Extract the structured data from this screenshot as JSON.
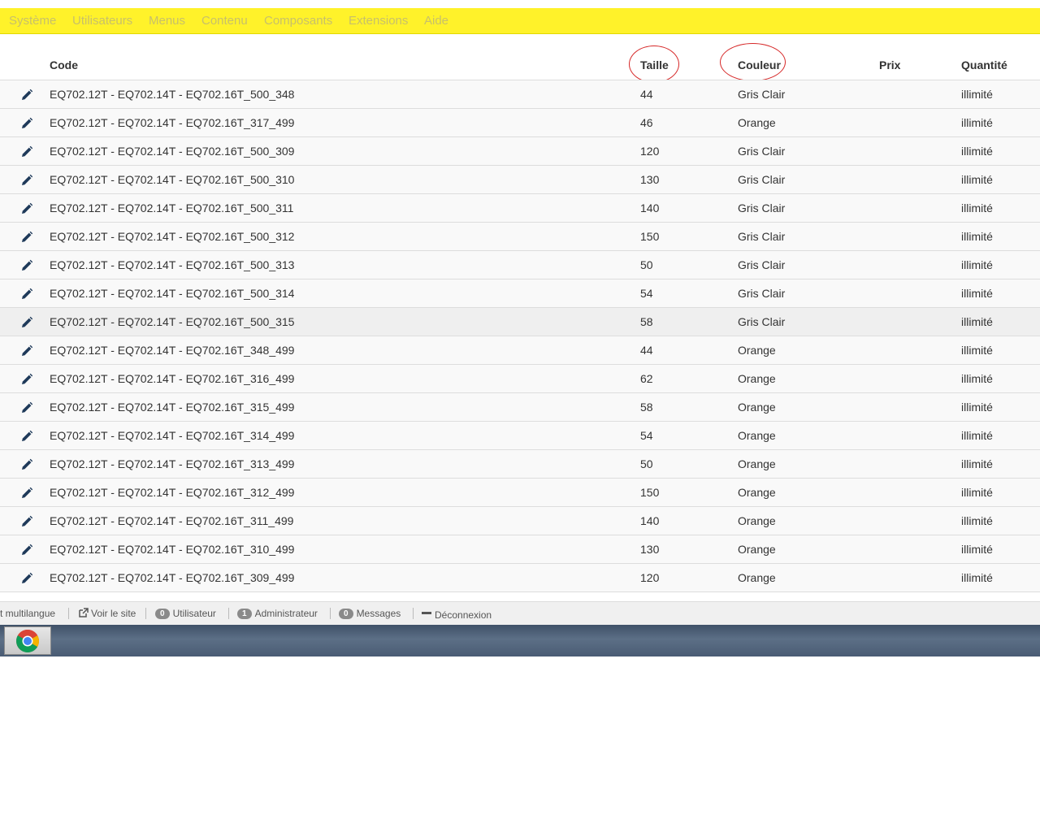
{
  "menubar": {
    "items": [
      "Système",
      "Utilisateurs",
      "Menus",
      "Contenu",
      "Composants",
      "Extensions",
      "Aide"
    ]
  },
  "table": {
    "headers": {
      "code": "Code",
      "taille": "Taille",
      "couleur": "Couleur",
      "prix": "Prix",
      "quantite": "Quantité"
    },
    "rows": [
      {
        "code": "EQ702.12T - EQ702.14T - EQ702.16T_500_348",
        "taille": "44",
        "couleur": "Gris Clair",
        "prix": "",
        "quantite": "illimité"
      },
      {
        "code": "EQ702.12T - EQ702.14T - EQ702.16T_317_499",
        "taille": "46",
        "couleur": "Orange",
        "prix": "",
        "quantite": "illimité"
      },
      {
        "code": "EQ702.12T - EQ702.14T - EQ702.16T_500_309",
        "taille": "120",
        "couleur": "Gris Clair",
        "prix": "",
        "quantite": "illimité"
      },
      {
        "code": "EQ702.12T - EQ702.14T - EQ702.16T_500_310",
        "taille": "130",
        "couleur": "Gris Clair",
        "prix": "",
        "quantite": "illimité"
      },
      {
        "code": "EQ702.12T - EQ702.14T - EQ702.16T_500_311",
        "taille": "140",
        "couleur": "Gris Clair",
        "prix": "",
        "quantite": "illimité"
      },
      {
        "code": "EQ702.12T - EQ702.14T - EQ702.16T_500_312",
        "taille": "150",
        "couleur": "Gris Clair",
        "prix": "",
        "quantite": "illimité"
      },
      {
        "code": "EQ702.12T - EQ702.14T - EQ702.16T_500_313",
        "taille": "50",
        "couleur": "Gris Clair",
        "prix": "",
        "quantite": "illimité"
      },
      {
        "code": "EQ702.12T - EQ702.14T - EQ702.16T_500_314",
        "taille": "54",
        "couleur": "Gris Clair",
        "prix": "",
        "quantite": "illimité"
      },
      {
        "code": "EQ702.12T - EQ702.14T - EQ702.16T_500_315",
        "taille": "58",
        "couleur": "Gris Clair",
        "prix": "",
        "quantite": "illimité"
      },
      {
        "code": "EQ702.12T - EQ702.14T - EQ702.16T_348_499",
        "taille": "44",
        "couleur": "Orange",
        "prix": "",
        "quantite": "illimité"
      },
      {
        "code": "EQ702.12T - EQ702.14T - EQ702.16T_316_499",
        "taille": "62",
        "couleur": "Orange",
        "prix": "",
        "quantite": "illimité"
      },
      {
        "code": "EQ702.12T - EQ702.14T - EQ702.16T_315_499",
        "taille": "58",
        "couleur": "Orange",
        "prix": "",
        "quantite": "illimité"
      },
      {
        "code": "EQ702.12T - EQ702.14T - EQ702.16T_314_499",
        "taille": "54",
        "couleur": "Orange",
        "prix": "",
        "quantite": "illimité"
      },
      {
        "code": "EQ702.12T - EQ702.14T - EQ702.16T_313_499",
        "taille": "50",
        "couleur": "Orange",
        "prix": "",
        "quantite": "illimité"
      },
      {
        "code": "EQ702.12T - EQ702.14T - EQ702.16T_312_499",
        "taille": "150",
        "couleur": "Orange",
        "prix": "",
        "quantite": "illimité"
      },
      {
        "code": "EQ702.12T - EQ702.14T - EQ702.16T_311_499",
        "taille": "140",
        "couleur": "Orange",
        "prix": "",
        "quantite": "illimité"
      },
      {
        "code": "EQ702.12T - EQ702.14T - EQ702.16T_310_499",
        "taille": "130",
        "couleur": "Orange",
        "prix": "",
        "quantite": "illimité"
      },
      {
        "code": "EQ702.12T - EQ702.14T - EQ702.16T_309_499",
        "taille": "120",
        "couleur": "Orange",
        "prix": "",
        "quantite": "illimité"
      }
    ],
    "highlighted_row": 8,
    "edit_icon": "pencil-icon",
    "annotation_color": "#d62828"
  },
  "statusbar": {
    "multilang_label": "t multilangue",
    "view_site_label": "Voir le site",
    "user_count": "0",
    "user_label": "Utilisateur",
    "admin_count": "1",
    "admin_label": "Administrateur",
    "messages_count": "0",
    "messages_label": "Messages",
    "logout_label": "Déconnexion"
  },
  "taskbar": {
    "app_icon": "chrome-icon"
  },
  "colors": {
    "menubar_bg": "#fff22a",
    "menubar_text": "#c8c06a",
    "row_bg": "#f9f9f9",
    "row_highlight_bg": "#efefef",
    "edit_icon": "#1f3a5a"
  }
}
